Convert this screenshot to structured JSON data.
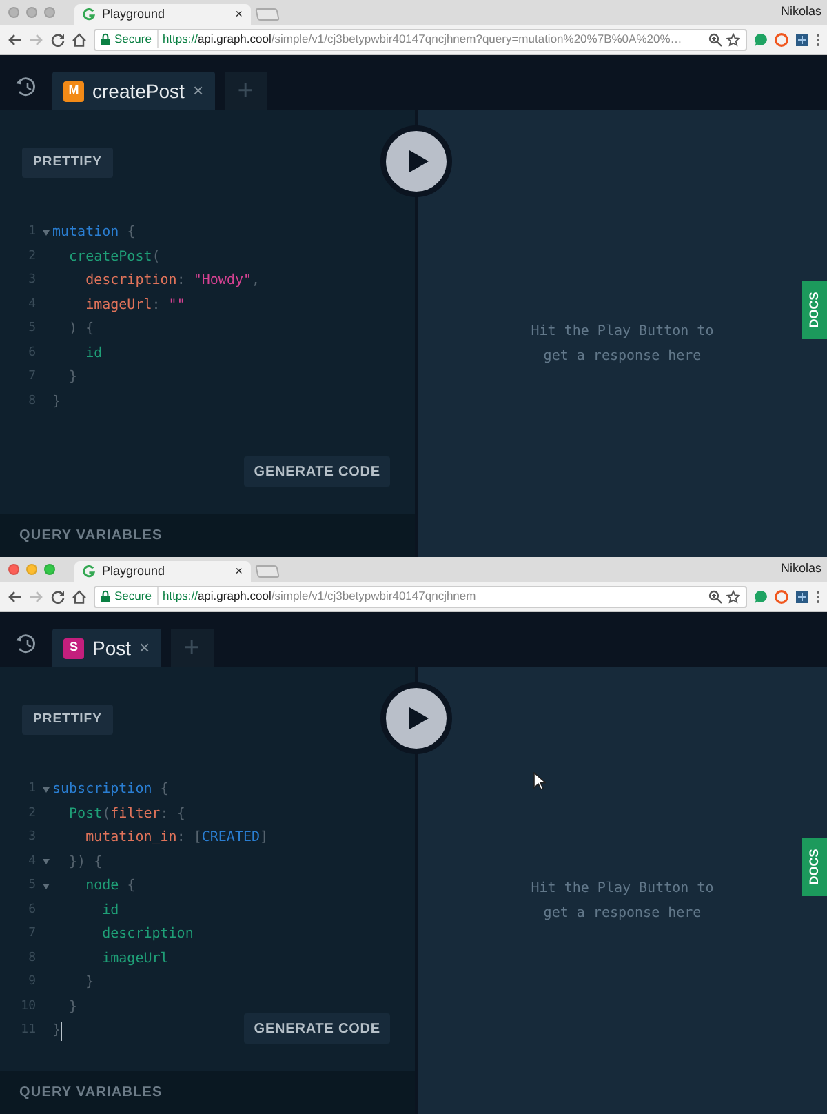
{
  "windows": [
    {
      "browser": {
        "focused": false,
        "tab_title": "Playground",
        "tab_close": "×",
        "profile": "Nikolas",
        "secure_label": "Secure",
        "url_scheme": "https://",
        "url_host": "api.graph.cool",
        "url_path": "/simple/v1/cj3betypwbir40147qncjhnem?query=mutation%20%7B%0A%20%…"
      },
      "tabs": [
        {
          "badge": {
            "text": "M",
            "color": "#f28a17"
          },
          "title": "createPost",
          "close": "×",
          "selected": true
        }
      ],
      "new_tab": "+",
      "prettify": "PRETTIFY",
      "code": [
        {
          "number": "1",
          "foldable": true,
          "caret": false,
          "tokens": [
            {
              "kind": "keyword",
              "text": "mutation"
            },
            {
              "kind": "punct",
              "text": " {"
            }
          ]
        },
        {
          "number": "2",
          "foldable": false,
          "caret": false,
          "tokens": [
            {
              "kind": "field",
              "text": "  createPost"
            },
            {
              "kind": "punct",
              "text": "("
            }
          ]
        },
        {
          "number": "3",
          "foldable": false,
          "caret": false,
          "tokens": [
            {
              "kind": "arg",
              "text": "    description"
            },
            {
              "kind": "punct",
              "text": ": "
            },
            {
              "kind": "string",
              "text": "\"Howdy\""
            },
            {
              "kind": "punct",
              "text": ","
            }
          ]
        },
        {
          "number": "4",
          "foldable": false,
          "caret": false,
          "tokens": [
            {
              "kind": "arg",
              "text": "    imageUrl"
            },
            {
              "kind": "punct",
              "text": ": "
            },
            {
              "kind": "string",
              "text": "\"\""
            }
          ]
        },
        {
          "number": "5",
          "foldable": false,
          "caret": false,
          "tokens": [
            {
              "kind": "punct",
              "text": "  ) {"
            }
          ]
        },
        {
          "number": "6",
          "foldable": false,
          "caret": false,
          "tokens": [
            {
              "kind": "field",
              "text": "    id"
            }
          ]
        },
        {
          "number": "7",
          "foldable": false,
          "caret": false,
          "tokens": [
            {
              "kind": "punct",
              "text": "  }"
            }
          ]
        },
        {
          "number": "8",
          "foldable": false,
          "caret": false,
          "tokens": [
            {
              "kind": "punct",
              "text": "}"
            }
          ]
        }
      ],
      "generate_code": "GENERATE CODE",
      "query_variables": "QUERY VARIABLES",
      "result_hint": "Hit the Play Button to get a response here",
      "docs": "DOCS",
      "mouse_pointer": false
    },
    {
      "browser": {
        "focused": true,
        "tab_title": "Playground",
        "tab_close": "×",
        "profile": "Nikolas",
        "secure_label": "Secure",
        "url_scheme": "https://",
        "url_host": "api.graph.cool",
        "url_path": "/simple/v1/cj3betypwbir40147qncjhnem"
      },
      "tabs": [
        {
          "badge": {
            "text": "S",
            "color": "#c41f7d"
          },
          "title": "Post",
          "close": "×",
          "selected": true
        }
      ],
      "new_tab": "+",
      "prettify": "PRETTIFY",
      "code": [
        {
          "number": "1",
          "foldable": true,
          "caret": false,
          "tokens": [
            {
              "kind": "keyword",
              "text": "subscription"
            },
            {
              "kind": "punct",
              "text": " {"
            }
          ]
        },
        {
          "number": "2",
          "foldable": false,
          "caret": false,
          "tokens": [
            {
              "kind": "field",
              "text": "  Post"
            },
            {
              "kind": "punct",
              "text": "("
            },
            {
              "kind": "arg",
              "text": "filter"
            },
            {
              "kind": "punct",
              "text": ": {"
            }
          ]
        },
        {
          "number": "3",
          "foldable": false,
          "caret": false,
          "tokens": [
            {
              "kind": "arg",
              "text": "    mutation_in"
            },
            {
              "kind": "punct",
              "text": ": ["
            },
            {
              "kind": "enum",
              "text": "CREATED"
            },
            {
              "kind": "punct",
              "text": "]"
            }
          ]
        },
        {
          "number": "4",
          "foldable": true,
          "caret": false,
          "tokens": [
            {
              "kind": "punct",
              "text": "  }) {"
            }
          ]
        },
        {
          "number": "5",
          "foldable": true,
          "caret": false,
          "tokens": [
            {
              "kind": "field",
              "text": "    node"
            },
            {
              "kind": "punct",
              "text": " {"
            }
          ]
        },
        {
          "number": "6",
          "foldable": false,
          "caret": false,
          "tokens": [
            {
              "kind": "field",
              "text": "      id"
            }
          ]
        },
        {
          "number": "7",
          "foldable": false,
          "caret": false,
          "tokens": [
            {
              "kind": "field",
              "text": "      description"
            }
          ]
        },
        {
          "number": "8",
          "foldable": false,
          "caret": false,
          "tokens": [
            {
              "kind": "field",
              "text": "      imageUrl"
            }
          ]
        },
        {
          "number": "9",
          "foldable": false,
          "caret": false,
          "tokens": [
            {
              "kind": "punct",
              "text": "    }"
            }
          ]
        },
        {
          "number": "10",
          "foldable": false,
          "caret": false,
          "tokens": [
            {
              "kind": "punct",
              "text": "  }"
            }
          ]
        },
        {
          "number": "11",
          "foldable": false,
          "caret": true,
          "tokens": [
            {
              "kind": "punct",
              "text": "}"
            }
          ]
        }
      ],
      "generate_code": "GENERATE CODE",
      "query_variables": "QUERY VARIABLES",
      "result_hint": "Hit the Play Button to get a response here",
      "docs": "DOCS",
      "mouse_pointer": true
    }
  ]
}
